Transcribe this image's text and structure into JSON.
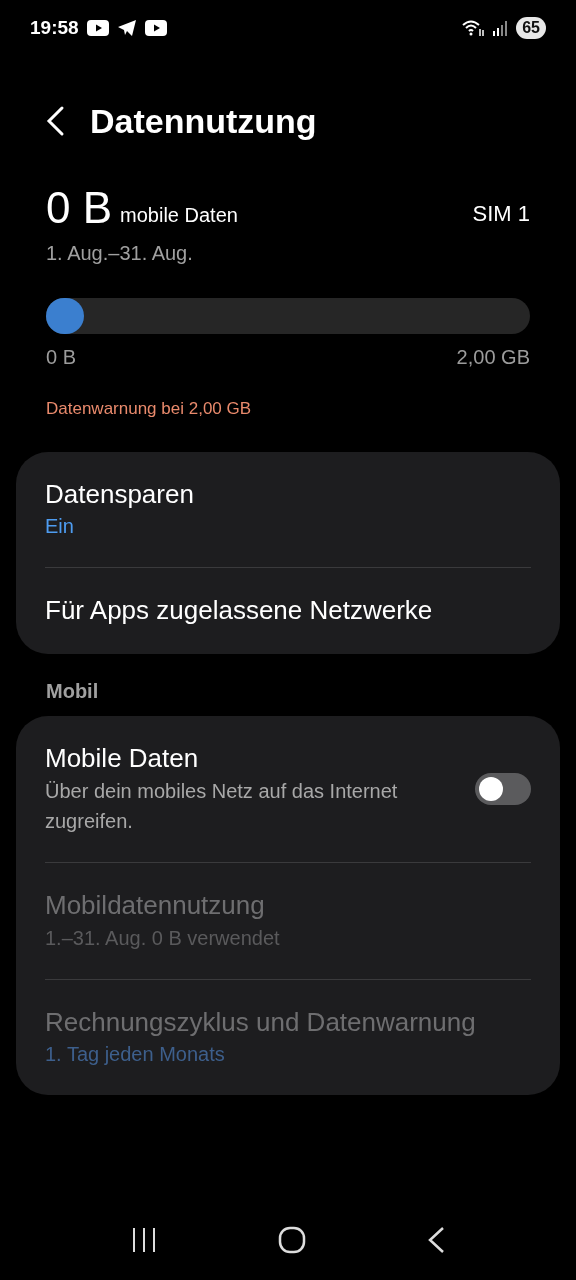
{
  "status_bar": {
    "time": "19:58",
    "battery": "65"
  },
  "header": {
    "title": "Datennutzung"
  },
  "usage": {
    "amount": "0 B",
    "amount_label": "mobile Daten",
    "sim": "SIM 1",
    "period": "1. Aug.–31. Aug.",
    "level": 0,
    "min_label": "0 B",
    "max_label": "2,00 GB",
    "warning": "Datenwarnung bei 2,00 GB"
  },
  "groups": [
    {
      "items": [
        {
          "kind": "plain",
          "title": "Datensparen",
          "subtitle": "Ein",
          "subtitle_accent": true,
          "disabled": false
        },
        {
          "kind": "plain",
          "title": "Für Apps zugelassene Netzwerke",
          "disabled": false
        }
      ]
    },
    {
      "heading": "Mobil",
      "items": [
        {
          "kind": "toggle",
          "title": "Mobile Daten",
          "subtitle": "Über dein mobiles Netz auf das Internet zugreifen.",
          "subtitle_accent": false,
          "on": false,
          "disabled": false
        },
        {
          "kind": "plain",
          "title": "Mobildatennutzung",
          "subtitle": "1.–31. Aug. 0 B verwendet",
          "subtitle_accent": false,
          "disabled": true
        },
        {
          "kind": "plain",
          "title": "Rechnungszyklus und Datenwarnung",
          "subtitle": "1. Tag jeden Monats",
          "subtitle_accent": true,
          "disabled": true
        }
      ]
    }
  ]
}
